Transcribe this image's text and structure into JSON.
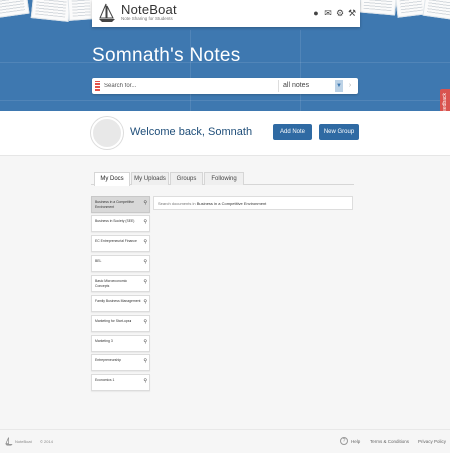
{
  "app": {
    "name": "NoteBoat",
    "tagline": "Note Sharing for Students"
  },
  "header_icons": [
    "user-icon",
    "inbox-icon",
    "gear-icon",
    "wrench-icon"
  ],
  "page": {
    "title": "Somnath's Notes"
  },
  "search": {
    "placeholder": "Search for...",
    "scope": "all notes"
  },
  "feedback": {
    "label": "Feedback"
  },
  "welcome": {
    "text": "Welcome back, Somnath",
    "add_note": "Add Note",
    "new_group": "New Group"
  },
  "tabs": [
    {
      "label": "My Docs",
      "active": true
    },
    {
      "label": "My Uploads",
      "active": false
    },
    {
      "label": "Groups",
      "active": false
    },
    {
      "label": "Following",
      "active": false
    }
  ],
  "docs": [
    {
      "label": "Business in a Competitive Environment",
      "selected": true
    },
    {
      "label": "Business in Society (SEE)"
    },
    {
      "label": "EC Entrepreneurial Finance"
    },
    {
      "label": "BEL"
    },
    {
      "label": "Basic Microeconomic Concepts"
    },
    {
      "label": "Family Business Management"
    },
    {
      "label": "Marketing for Start-ups♦"
    },
    {
      "label": "Marketing 3"
    },
    {
      "label": "Entrepreneurship"
    },
    {
      "label": "Economics 1"
    }
  ],
  "doc_search": {
    "prefix": "Search documents in",
    "target": "Business in a Competitive Environment"
  },
  "footer": {
    "brand": "NoteBoat",
    "copyright": "© 2014",
    "help": "Help",
    "terms": "Terms & Conditions",
    "privacy": "Privacy Policy"
  },
  "colors": {
    "hero": "#3e78b0",
    "button": "#2f6aa3",
    "feedback": "#d9534f",
    "welcome_text": "#1f4e79"
  }
}
